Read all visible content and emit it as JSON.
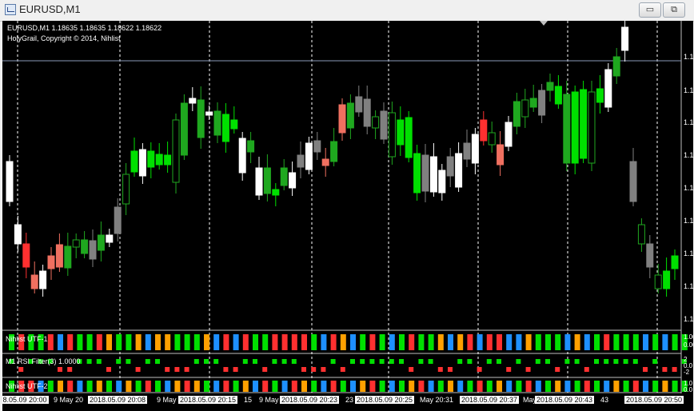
{
  "window": {
    "title": "EURUSD,M1",
    "minimize_glyph": "▭",
    "maximize_glyph": "⧉"
  },
  "chart": {
    "symbol_line": "EURUSD,M1  1.18635 1.18635 1.18622 1.18622",
    "copyright": "HolyGrail, Copyright © 2014, Nihlist",
    "price_labels": [
      "1.1",
      "1.1",
      "1.1",
      "1.1",
      "1.1",
      "1.1",
      "1.1",
      "1.1",
      "1.1"
    ],
    "colors": {
      "background": "#000000",
      "bull": "#00e000",
      "bear": "#ffffff",
      "dimmed_bull": "#1fa81f",
      "dimmed_bear": "#808080",
      "red": "#ff3030",
      "salmon": "#f07060",
      "orange": "#ffa000",
      "blue": "#1e90ff",
      "grid": "#ffffff"
    },
    "candle_colors": [
      "#ffffff",
      "#ffffff",
      "#ff3030",
      "#f07060",
      "#ffffff",
      "#f07060",
      "#f07060",
      "#1fa81f",
      "#1fa81f",
      "#1fa81f",
      "#808080",
      "#1fa81f",
      "#ffffff",
      "#808080",
      "#1fa81f",
      "#00e000",
      "#ffffff",
      "#00e000",
      "#00e000",
      "#00e000",
      "#1fa81f",
      "#1fa81f",
      "#ffffff",
      "#1fa81f",
      "#ffffff",
      "#1fa81f",
      "#00e000",
      "#00e000",
      "#ffffff",
      "#1fa81f",
      "#ffffff",
      "#1fa81f",
      "#00e000",
      "#1fa81f",
      "#ffffff",
      "#808080",
      "#ffffff",
      "#808080",
      "#f07060",
      "#1fa81f",
      "#f07060",
      "#1fa81f",
      "#808080",
      "#808080",
      "#1fa81f",
      "#808080",
      "#1fa81f",
      "#00e000",
      "#00e000",
      "#00e000",
      "#808080",
      "#ffffff",
      "#ffffff",
      "#808080",
      "#ffffff",
      "#808080",
      "#ffffff",
      "#ff3030",
      "#1fa81f",
      "#f07060",
      "#ffffff",
      "#1fa81f",
      "#1fa81f",
      "#1fa81f",
      "#808080",
      "#1fa81f",
      "#00e000",
      "#1fa81f",
      "#00e000",
      "#00e000",
      "#1fa81f",
      "#00e000",
      "#ffffff",
      "#1fa81f",
      "#ffffff",
      "#808080",
      "#1fa81f",
      "#808080",
      "#1fa81f",
      "#00e000",
      "#00e000"
    ]
  },
  "indicators": {
    "utf1": {
      "label": "Nihlist UTF-1",
      "scale_top": "1.00",
      "scale_bottom": "0.00",
      "colors": [
        "#00e000",
        "#ff3030",
        "#00e000",
        "#00e000",
        "#ff3030",
        "#1e90ff",
        "#ff3030",
        "#00e000",
        "#00e000",
        "#ff3030",
        "#ffa000",
        "#00e000",
        "#00e000",
        "#ffa000",
        "#1e90ff",
        "#ffa000",
        "#ffa000",
        "#00e000",
        "#00e000",
        "#00e000",
        "#ffa000",
        "#1e90ff",
        "#ff3030",
        "#1e90ff",
        "#ff3030",
        "#00e000",
        "#00e000",
        "#ff3030",
        "#ff3030",
        "#ff3030",
        "#ff3030",
        "#00e000",
        "#1e90ff",
        "#ff3030",
        "#ffa000",
        "#1e90ff",
        "#00e000",
        "#ff3030",
        "#00e000",
        "#1e90ff",
        "#00e000",
        "#ff3030",
        "#00e000",
        "#00e000",
        "#ffa000",
        "#1e90ff",
        "#ffa000",
        "#ff3030",
        "#1e90ff",
        "#ff3030",
        "#ff3030",
        "#1e90ff",
        "#1e90ff",
        "#ffa000",
        "#00e000",
        "#00e000",
        "#00e000",
        "#1e90ff",
        "#ffa000",
        "#1e90ff",
        "#00e000",
        "#ff3030",
        "#00e000",
        "#00e000",
        "#00e000",
        "#1e90ff",
        "#00e000",
        "#1e90ff",
        "#00e000",
        "#00e000"
      ]
    },
    "rsi": {
      "label": "M1 RSI Filter(3) 1.0000",
      "scale_top": "2",
      "scale_mid": "0.0",
      "scale_bottom": "-2",
      "states": [
        1,
        -1,
        1,
        1,
        1,
        -1,
        -1,
        1,
        1,
        1,
        -1,
        1,
        1,
        -1,
        1,
        1,
        -1,
        -1,
        -1,
        1,
        1,
        1,
        -1,
        -1,
        1,
        1,
        -1,
        1,
        1,
        1,
        -1,
        -1,
        -1,
        1,
        -1,
        1,
        1,
        1,
        1,
        1,
        1,
        -1,
        1,
        1,
        -1,
        -1,
        1,
        1,
        -1,
        1,
        1,
        -1,
        1,
        -1,
        1,
        1,
        -1,
        1,
        1,
        -1,
        1,
        1,
        1,
        1,
        1,
        -1,
        1,
        -1,
        -1,
        1
      ]
    },
    "utf2": {
      "label": "Nihlist UTF-2",
      "scale_top": "1.0",
      "scale_bottom": "0.0",
      "colors": [
        "#00e000",
        "#ff3030",
        "#ff3030",
        "#1e90ff",
        "#00e000",
        "#ffa000",
        "#ff3030",
        "#1e90ff",
        "#00e000",
        "#ffa000",
        "#00e000",
        "#1e90ff",
        "#ffa000",
        "#00e000",
        "#ff3030",
        "#00e000",
        "#1e90ff",
        "#ffa000",
        "#ff3030",
        "#ffa000",
        "#00e000",
        "#1e90ff",
        "#ff3030",
        "#00e000",
        "#ffa000",
        "#1e90ff",
        "#ff3030",
        "#00e000",
        "#1e90ff",
        "#ff3030",
        "#ffa000",
        "#00e000",
        "#1e90ff",
        "#ff3030",
        "#00e000",
        "#1e90ff",
        "#ffa000",
        "#ff3030",
        "#00e000",
        "#1e90ff",
        "#00e000",
        "#ffa000",
        "#ff3030",
        "#1e90ff",
        "#00e000",
        "#ffa000",
        "#1e90ff",
        "#00e000",
        "#ff3030",
        "#00e000",
        "#ffa000",
        "#1e90ff",
        "#00e000",
        "#ff3030",
        "#1e90ff",
        "#00e000",
        "#ffa000",
        "#1e90ff",
        "#00e000",
        "#ff3030",
        "#00e000",
        "#1e90ff",
        "#ffa000",
        "#00e000",
        "#ff3030",
        "#1e90ff",
        "#00e000",
        "#ffa000",
        "#00e000",
        "#00e000"
      ]
    }
  },
  "time_axis": [
    {
      "text": ".8.05.09 20:00",
      "hl": true
    },
    {
      "text": "9 May 20",
      "hl": false
    },
    {
      "text": "2018.05.09 20:08",
      "hl": true
    },
    {
      "text": "9 May",
      "hl": false
    },
    {
      "text": "2018.05.09 20:15",
      "hl": true
    },
    {
      "text": "15",
      "hl": false
    },
    {
      "text": "9 May",
      "hl": false
    },
    {
      "text": "2018.05.09 20:23",
      "hl": true
    },
    {
      "text": "23",
      "hl": false
    },
    {
      "text": "2018.05.09 20:25",
      "hl": true
    },
    {
      "text": "May 20:31",
      "hl": false
    },
    {
      "text": "2018.05.09 20:37",
      "hl": true
    },
    {
      "text": "May",
      "hl": false
    },
    {
      "text": "2018.05.09 20:43",
      "hl": true
    },
    {
      "text": "43",
      "hl": false
    },
    {
      "text": "2018.05.09 20:50",
      "hl": true
    }
  ]
}
